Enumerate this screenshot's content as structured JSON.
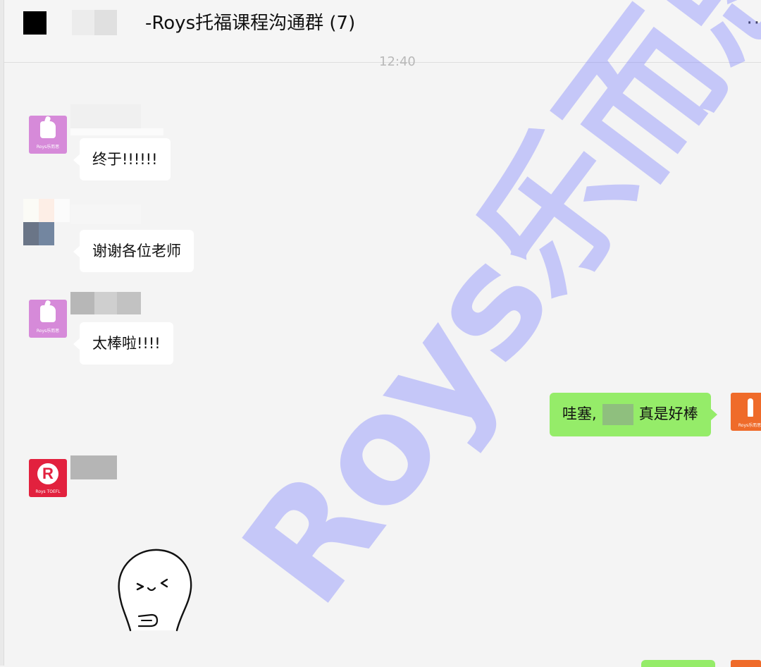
{
  "header": {
    "title": "-Roys托福课程沟通群 (7)",
    "more": "··"
  },
  "time_stamp": "12:40",
  "messages": [
    {
      "side": "left",
      "avatar": "roys-pink-thumb",
      "avatar_caption": "Roys乐而思",
      "text": "终于!!!!!!"
    },
    {
      "side": "left",
      "avatar": "blurred-photo",
      "text": "谢谢各位老师"
    },
    {
      "side": "left",
      "avatar": "roys-pink-thumb",
      "avatar_caption": "Roys乐而思",
      "text": "太棒啦!!!!"
    },
    {
      "side": "right",
      "avatar": "roys-orange-figure",
      "avatar_caption": "Roys乐而思",
      "text_before": "哇塞,",
      "text_after": "真是好棒"
    },
    {
      "side": "left",
      "avatar": "roys-toefl-logo",
      "avatar_logo": "R",
      "avatar_caption": "Roys TOEFL",
      "content": "sticker"
    }
  ],
  "watermark": "Roys乐而思",
  "colors": {
    "self_bubble": "#95ec69",
    "other_bubble": "#ffffff",
    "background": "#f4f4f4",
    "watermark": "#787dff"
  }
}
